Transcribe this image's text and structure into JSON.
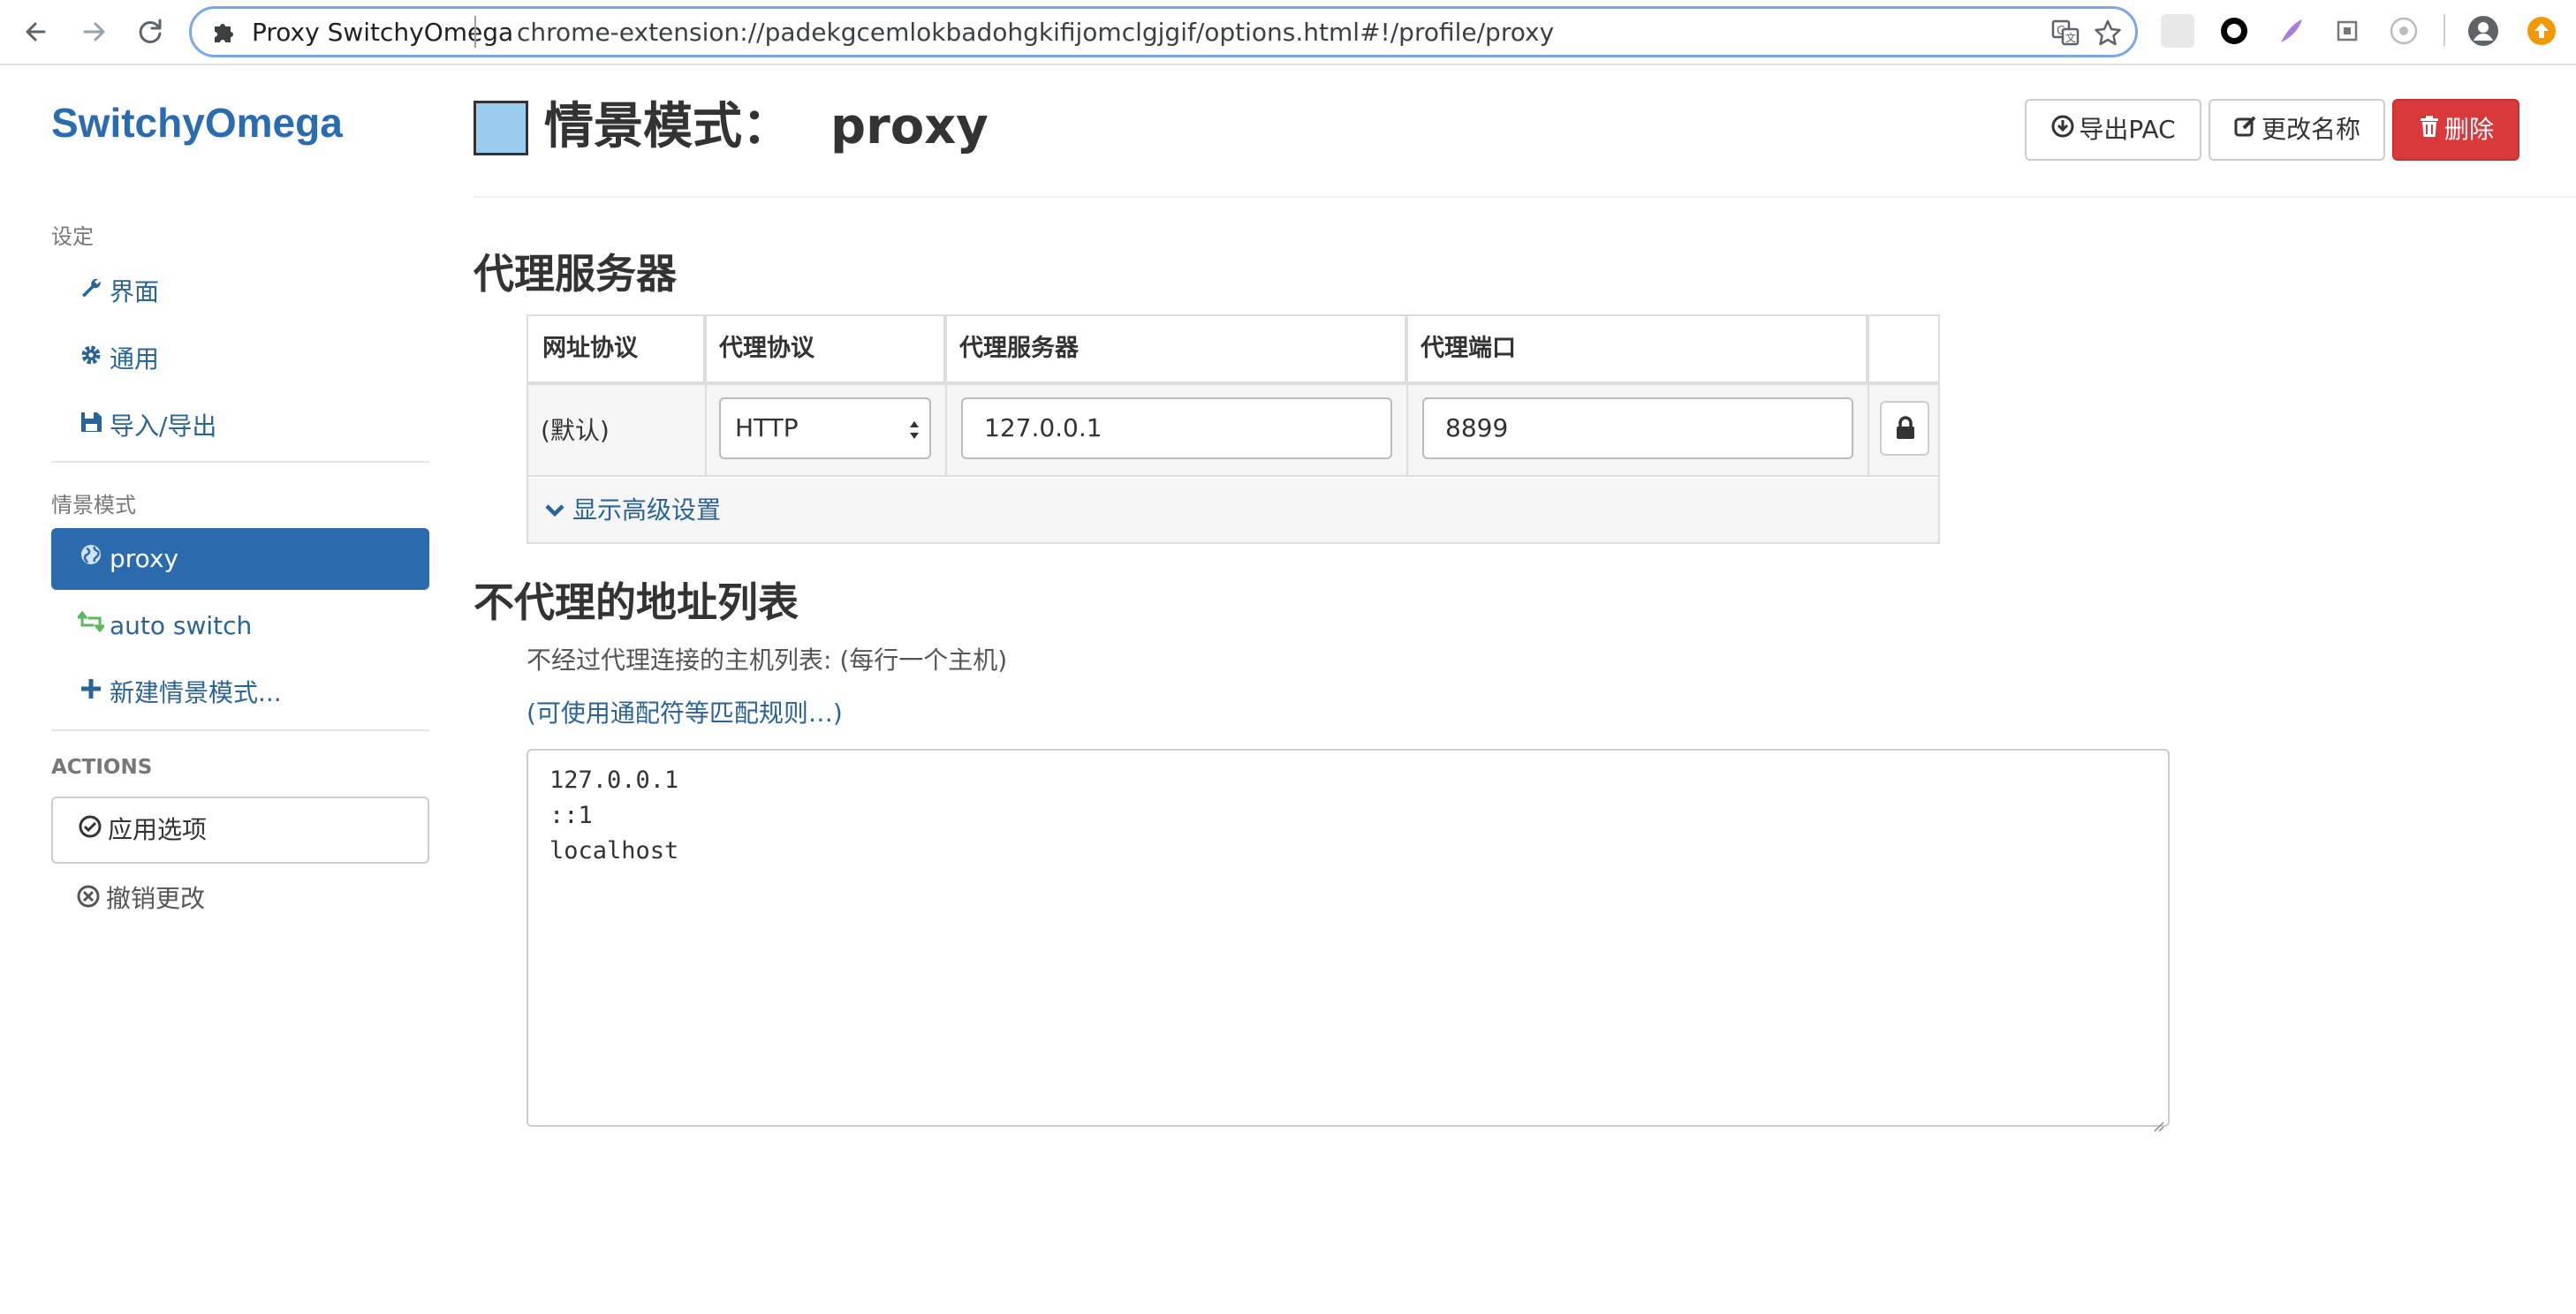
{
  "browser": {
    "site_label": "Proxy SwitchyOmega",
    "url": "chrome-extension://padekgcemlokbadohgkifijomclgjgif/options.html#!/profile/proxy",
    "icons": {
      "back": "arrow-left-icon",
      "forward": "arrow-right-icon",
      "reload": "reload-icon",
      "extension": "puzzle-icon",
      "translate": "translate-icon",
      "bookmark": "star-icon",
      "profile": "account-icon",
      "update": "update-icon"
    },
    "colors": {
      "focus_ring": "#7ba7e8"
    }
  },
  "sidebar": {
    "brand": "SwitchyOmega",
    "settings_header": "设定",
    "settings_items": [
      {
        "label": "界面",
        "icon": "wrench-icon"
      },
      {
        "label": "通用",
        "icon": "gear-icon"
      },
      {
        "label": "导入/导出",
        "icon": "floppy-icon"
      }
    ],
    "profiles_header": "情景模式",
    "profiles": [
      {
        "label": "proxy",
        "icon": "globe-icon",
        "active": true
      },
      {
        "label": "auto switch",
        "icon": "retweet-icon",
        "active": false
      },
      {
        "label": "新建情景模式...",
        "icon": "plus-icon",
        "active": false
      }
    ],
    "actions_header": "ACTIONS",
    "apply_label": "应用选项",
    "discard_label": "撤销更改"
  },
  "header": {
    "title_prefix": "情景模式：",
    "profile_name": "proxy",
    "profile_color": "#99ccee",
    "export_label": "导出PAC",
    "rename_label": "更改名称",
    "delete_label": "删除"
  },
  "proxy_servers": {
    "section_title": "代理服务器",
    "columns": [
      "网址协议",
      "代理协议",
      "代理服务器",
      "代理端口"
    ],
    "rows": [
      {
        "scheme": "(默认)",
        "protocol": "HTTP",
        "server": "127.0.0.1",
        "port": "8899"
      }
    ],
    "advanced_label": "显示高级设置"
  },
  "bypass": {
    "section_title": "不代理的地址列表",
    "help": "不经过代理连接的主机列表: (每行一个主机)",
    "wildcard_link": "(可使用通配符等匹配规则…)",
    "lines": [
      "127.0.0.1",
      "::1",
      "localhost"
    ]
  },
  "theme": {
    "primary": "#2b6aad",
    "link": "#2a6496",
    "danger": "#d9393b"
  }
}
